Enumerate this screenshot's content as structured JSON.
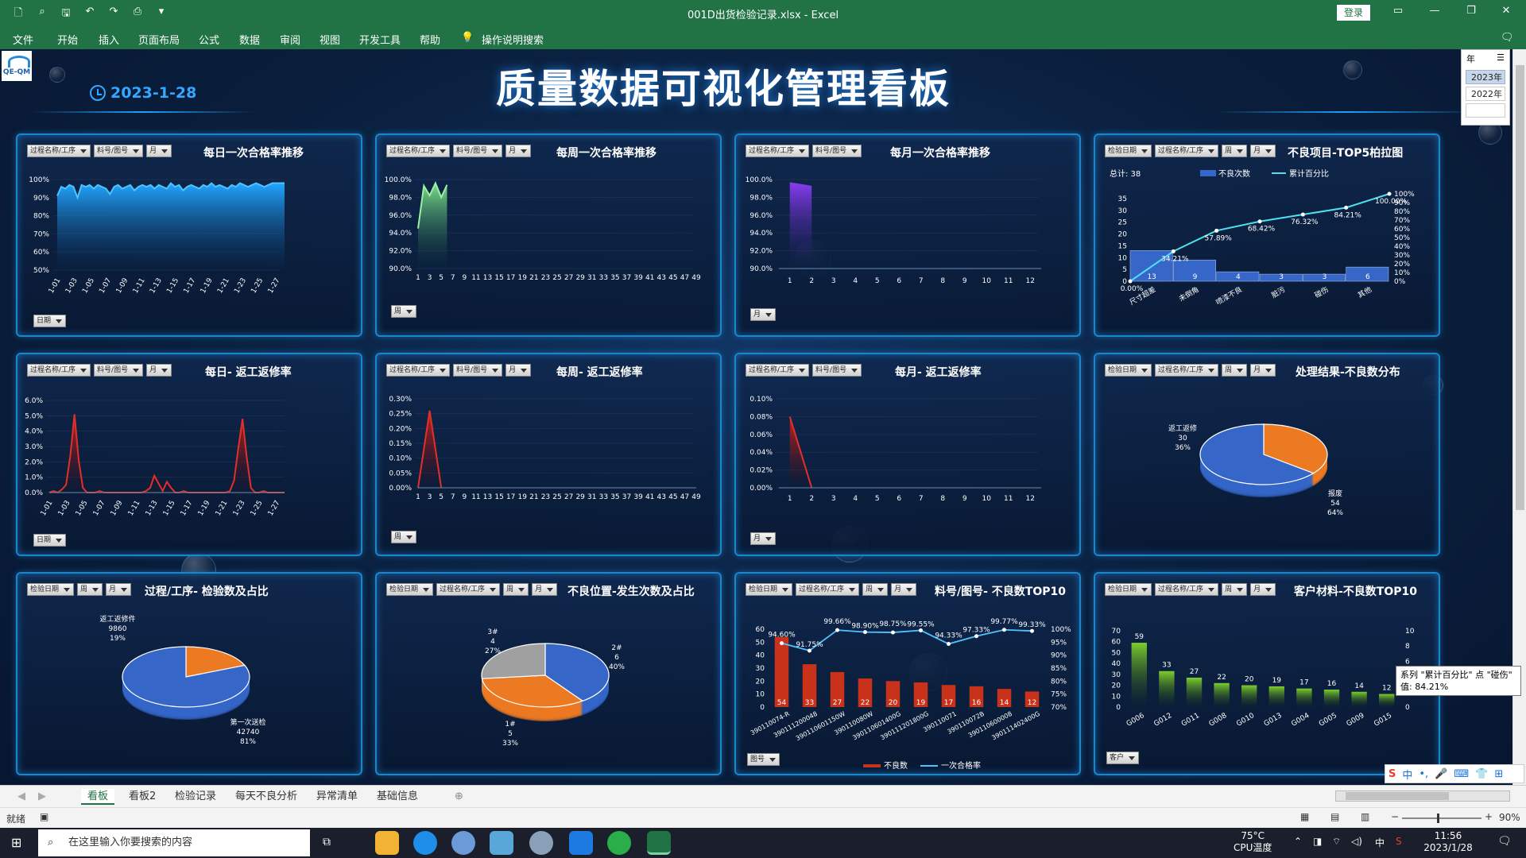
{
  "window": {
    "title": "001D出货检验记录.xlsx  -  Excel",
    "login": "登录"
  },
  "menu": [
    "文件",
    "开始",
    "插入",
    "页面布局",
    "公式",
    "数据",
    "审阅",
    "视图",
    "开发工具",
    "帮助",
    "操作说明搜索"
  ],
  "dashboard": {
    "title": "质量数据可视化管理看板",
    "date": "2023-1-28",
    "logo_text": "QE-QM"
  },
  "slicer": {
    "header": "年",
    "items": [
      "2023年",
      "2022年",
      ""
    ]
  },
  "filters": {
    "proc": "过程名称/工序",
    "part": "料号/图号",
    "month": "月",
    "week": "周",
    "date": "检验日期",
    "day": "日期",
    "cust": "客户"
  },
  "panels": {
    "p1": {
      "title": "每日一次合格率推移",
      "axis_btn": "日期"
    },
    "p2": {
      "title": "每周一次合格率推移",
      "axis_btn": "周"
    },
    "p3": {
      "title": "每月一次合格率推移",
      "axis_btn": "月"
    },
    "p4": {
      "title": "不良项目-TOP5柏拉图",
      "total": "总计:  38"
    },
    "p5": {
      "title": "每日- 返工返修率",
      "axis_btn": "日期"
    },
    "p6": {
      "title": "每周- 返工返修率",
      "axis_btn": "周"
    },
    "p7": {
      "title": "每月- 返工返修率",
      "axis_btn": "月"
    },
    "p8": {
      "title": "处理结果-不良数分布"
    },
    "p9": {
      "title": "过程/工序- 检验数及占比"
    },
    "p10": {
      "title": "不良位置-发生次数及占比"
    },
    "p11": {
      "title": "料号/图号- 不良数TOP10",
      "axis_btn": "图号"
    },
    "p12": {
      "title": "客户材料-不良数TOP10",
      "axis_btn": "客户"
    }
  },
  "tooltip": {
    "line1": "系列 \"累计百分比\" 点 \"碰伤\"",
    "line2": "值: 84.21%"
  },
  "sheet_tabs": [
    "看板",
    "看板2",
    "检验记录",
    "每天不良分析",
    "异常清单",
    "基础信息"
  ],
  "status": {
    "left": "就绪",
    "zoom": "90%"
  },
  "taskbar": {
    "search": "在这里输入你要搜索的内容",
    "temp": "75°C",
    "temp_label": "CPU温度",
    "time": "11:56",
    "date": "2023/1/28",
    "ime": "中"
  },
  "colors": {
    "excel_green": "#217346",
    "panel_border": "#1b86c9",
    "accent_blue": "#35a7ff",
    "bar_blue": "#3566c8",
    "bar_red": "#c8321a",
    "bar_green": "#6fb52c",
    "pie_blue": "#3566c8",
    "pie_orange": "#ec7a23",
    "pie_gray": "#a0a0a0"
  },
  "chart_data": [
    {
      "type": "area",
      "id": "daily_pass",
      "categories": [
        "1-01",
        "1-03",
        "1-05",
        "1-07",
        "1-09",
        "1-11",
        "1-13",
        "1-15",
        "1-17",
        "1-19",
        "1-21",
        "1-23",
        "1-25",
        "1-27"
      ],
      "y_ticks": [
        "50%",
        "60%",
        "70%",
        "80%",
        "90%",
        "100%"
      ],
      "ylim": [
        50,
        100
      ],
      "values": [
        91,
        96,
        95,
        97,
        96,
        90,
        97,
        96,
        97,
        95,
        97,
        96,
        95,
        92,
        96,
        97,
        95,
        96,
        97,
        94,
        96,
        97,
        96,
        97,
        95,
        97,
        96,
        95,
        98,
        96,
        97,
        94,
        96,
        97,
        96,
        95,
        97,
        96,
        98,
        96,
        97,
        96,
        95,
        97,
        96,
        98,
        97,
        96,
        97,
        98,
        97,
        96,
        97,
        98,
        98,
        98,
        98
      ]
    },
    {
      "type": "area",
      "id": "weekly_pass",
      "x_ticks": [
        "1",
        "3",
        "5",
        "7",
        "9",
        "11",
        "13",
        "15",
        "17",
        "19",
        "21",
        "23",
        "25",
        "27",
        "29",
        "31",
        "33",
        "35",
        "37",
        "39",
        "41",
        "43",
        "45",
        "47",
        "49"
      ],
      "y_ticks": [
        "90.0%",
        "92.0%",
        "94.0%",
        "96.0%",
        "98.0%",
        "100.0%"
      ],
      "ylim": [
        90,
        100
      ],
      "values": [
        94.5,
        99.3,
        98.2,
        99.6,
        98.0,
        99.4
      ]
    },
    {
      "type": "bar",
      "id": "monthly_pass",
      "categories": [
        "1",
        "2",
        "3",
        "4",
        "5",
        "6",
        "7",
        "8",
        "9",
        "10",
        "11",
        "12"
      ],
      "y_ticks": [
        "90.0%",
        "92.0%",
        "94.0%",
        "96.0%",
        "98.0%",
        "100.0%"
      ],
      "ylim": [
        90,
        100
      ],
      "values": [
        99.7,
        99.3
      ]
    },
    {
      "type": "bar+line",
      "id": "pareto",
      "categories": [
        "尺寸超差",
        "未倒角",
        "喷漆不良",
        "脏污",
        "碰伤",
        "其他"
      ],
      "bars": [
        13,
        9,
        4,
        3,
        3,
        6
      ],
      "cumulative": [
        0.0,
        34.21,
        57.89,
        68.42,
        76.32,
        84.21,
        100.0
      ],
      "cumulative_labels": [
        "0.00%",
        "34.21%",
        "57.89%",
        "68.42%",
        "76.32%",
        "84.21%",
        "100.00%"
      ],
      "y_ticks": [
        "0",
        "5",
        "10",
        "15",
        "20",
        "25",
        "30",
        "35"
      ],
      "y2_ticks": [
        "0%",
        "10%",
        "20%",
        "30%",
        "40%",
        "50%",
        "60%",
        "70%",
        "80%",
        "90%",
        "100%"
      ],
      "legend": [
        "不良次数",
        "累计百分比"
      ]
    },
    {
      "type": "area",
      "id": "daily_rework",
      "categories": [
        "1-01",
        "1-03",
        "1-05",
        "1-07",
        "1-09",
        "1-11",
        "1-13",
        "1-15",
        "1-17",
        "1-19",
        "1-21",
        "1-23",
        "1-25",
        "1-27"
      ],
      "y_ticks": [
        "0.0%",
        "1.0%",
        "2.0%",
        "3.0%",
        "4.0%",
        "5.0%",
        "6.0%"
      ],
      "ylim": [
        0,
        6
      ],
      "values": [
        0,
        0.1,
        0,
        0.2,
        0.5,
        2.4,
        5.1,
        2.1,
        0.3,
        0,
        0,
        0,
        0.1,
        0,
        0,
        0,
        0,
        0,
        0,
        0,
        0,
        0,
        0,
        0.1,
        0.3,
        1.1,
        0.6,
        0.1,
        0.7,
        0.3,
        0,
        0,
        0.1,
        0,
        0,
        0,
        0,
        0,
        0,
        0,
        0,
        0,
        0,
        0.1,
        0.8,
        2.9,
        4.8,
        2.3,
        0.3,
        0,
        0,
        0.1,
        0,
        0,
        0,
        0,
        0
      ]
    },
    {
      "type": "area",
      "id": "weekly_rework",
      "x_ticks": [
        "1",
        "3",
        "5",
        "7",
        "9",
        "11",
        "13",
        "15",
        "17",
        "19",
        "21",
        "23",
        "25",
        "27",
        "29",
        "31",
        "33",
        "35",
        "37",
        "39",
        "41",
        "43",
        "45",
        "47",
        "49"
      ],
      "y_ticks": [
        "0.00%",
        "0.05%",
        "0.10%",
        "0.15%",
        "0.20%",
        "0.25%",
        "0.30%"
      ],
      "ylim": [
        0,
        0.3
      ],
      "values": [
        0,
        0.26,
        0
      ]
    },
    {
      "type": "area",
      "id": "monthly_rework",
      "categories": [
        "1",
        "2",
        "3",
        "4",
        "5",
        "6",
        "7",
        "8",
        "9",
        "10",
        "11",
        "12"
      ],
      "y_ticks": [
        "0.00%",
        "0.02%",
        "0.04%",
        "0.06%",
        "0.08%",
        "0.10%"
      ],
      "ylim": [
        0,
        0.1
      ],
      "values": [
        0.08,
        0
      ]
    },
    {
      "type": "pie",
      "id": "disposition",
      "slices": [
        {
          "label": "返工返修",
          "value": 30,
          "pct": "36%"
        },
        {
          "label": "报废",
          "value": 54,
          "pct": "64%"
        }
      ]
    },
    {
      "type": "pie",
      "id": "process",
      "slices": [
        {
          "label": "返工返修件",
          "value": 9860,
          "pct": "19%"
        },
        {
          "label": "第一次送检",
          "value": 42740,
          "pct": "81%"
        }
      ]
    },
    {
      "type": "pie",
      "id": "location",
      "slices": [
        {
          "label": "2#",
          "value": 6,
          "pct": "40%"
        },
        {
          "label": "1#",
          "value": 5,
          "pct": "33%"
        },
        {
          "label": "3#",
          "value": 4,
          "pct": "27%"
        }
      ]
    },
    {
      "type": "bar+line",
      "id": "part_top10",
      "categories": [
        "390110074-R",
        "390111200048",
        "390110601150W",
        "390110080W",
        "390110601400G",
        "390111201800G",
        "390110071",
        "390110072B",
        "390110600008",
        "390111402400G"
      ],
      "bars": [
        54,
        33,
        27,
        22,
        20,
        19,
        17,
        16,
        14,
        12
      ],
      "rates": [
        94.6,
        91.75,
        99.66,
        98.9,
        98.75,
        99.55,
        94.33,
        97.33,
        99.77,
        99.33
      ],
      "rate_labels": [
        "94.60%",
        "91.75%",
        "99.66%",
        "98.90%",
        "98.75%",
        "99.55%",
        "94.33%",
        "97.33%",
        "99.77%",
        "99.33%"
      ],
      "y_ticks": [
        "0",
        "10",
        "20",
        "30",
        "40",
        "50",
        "60"
      ],
      "y2_ticks": [
        "70%",
        "75%",
        "80%",
        "85%",
        "90%",
        "95%",
        "100%"
      ],
      "legend": [
        "不良数",
        "一次合格率"
      ]
    },
    {
      "type": "bar",
      "id": "customer_top10",
      "categories": [
        "G006",
        "G012",
        "G011",
        "G008",
        "G010",
        "G013",
        "G004",
        "G005",
        "G009",
        "G015"
      ],
      "values": [
        59,
        33,
        27,
        22,
        20,
        19,
        17,
        16,
        14,
        12
      ],
      "y_ticks": [
        "0",
        "10",
        "20",
        "30",
        "40",
        "50",
        "60",
        "70"
      ],
      "y2_ticks": [
        "0",
        "2",
        "4",
        "6",
        "8",
        "10"
      ]
    }
  ]
}
